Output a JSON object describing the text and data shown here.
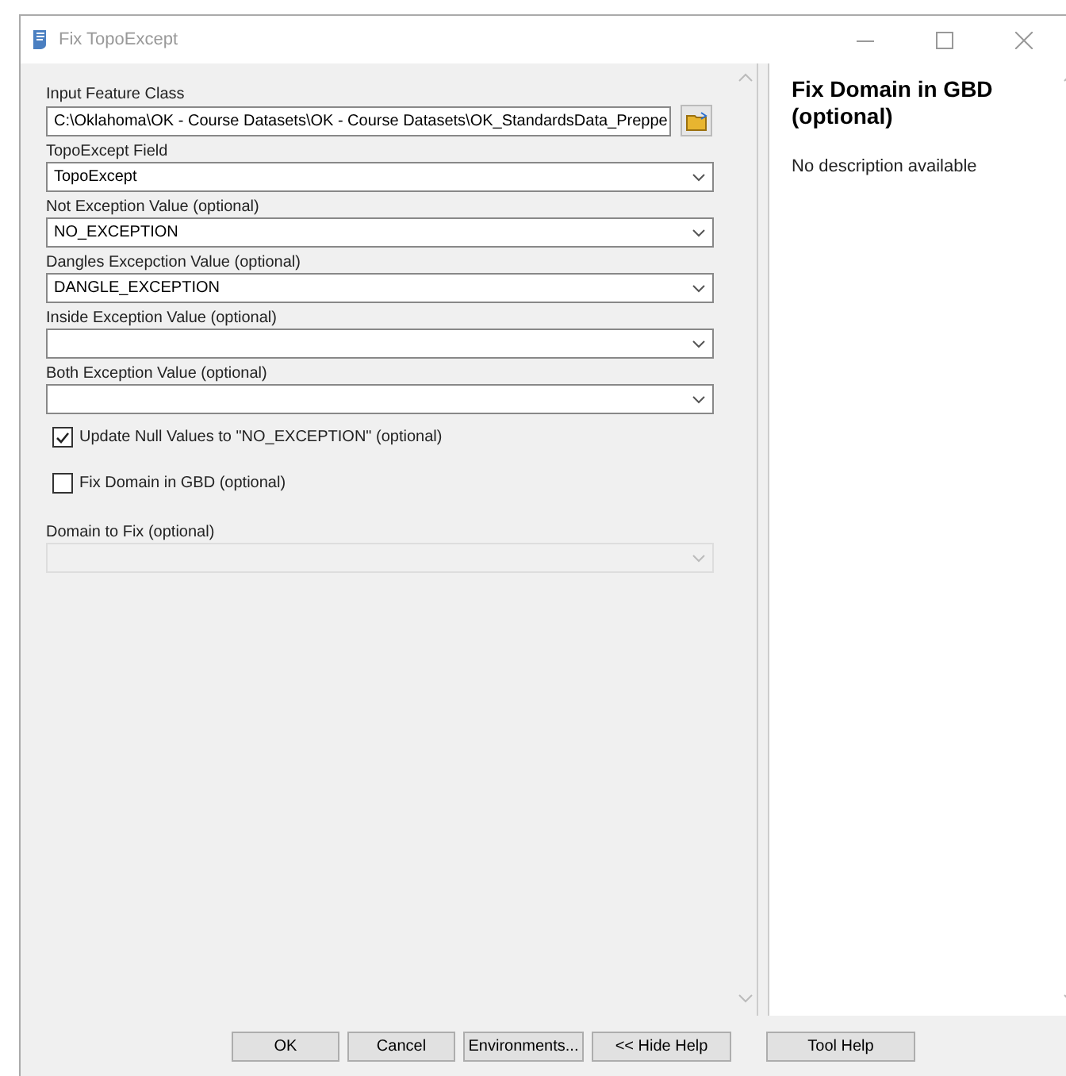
{
  "window": {
    "title": "Fix TopoExcept"
  },
  "parameters": [
    {
      "kind": "path",
      "label": "Input Feature Class",
      "value": "C:\\Oklahoma\\OK - Course Datasets\\OK - Course Datasets\\OK_StandardsData_Preppe"
    },
    {
      "kind": "dropdown",
      "label": "TopoExcept Field",
      "value": "TopoExcept",
      "disabled": false
    },
    {
      "kind": "dropdown",
      "label": "Not Exception Value (optional)",
      "value": "NO_EXCEPTION",
      "disabled": false
    },
    {
      "kind": "dropdown",
      "label": "Dangles Excepction Value (optional)",
      "value": "DANGLE_EXCEPTION",
      "disabled": false
    },
    {
      "kind": "dropdown",
      "label": "Inside Exception Value (optional)",
      "disabled": false
    },
    {
      "kind": "dropdown",
      "label": "Both Exception Value (optional)",
      "disabled": false
    },
    {
      "kind": "checkbox",
      "label": "Update Null Values to \"NO_EXCEPTION\" (optional)",
      "checked": true
    },
    {
      "kind": "checkbox",
      "label": "Fix Domain in GBD (optional)",
      "checked": false
    },
    {
      "kind": "dropdown",
      "label": "Domain to Fix (optional)",
      "disabled": true
    }
  ],
  "help": {
    "title": "Fix Domain in GBD (optional)",
    "description": "No description available"
  },
  "buttons": [
    "OK",
    "Cancel",
    "Environments...",
    "<< Hide Help",
    "Tool Help"
  ]
}
